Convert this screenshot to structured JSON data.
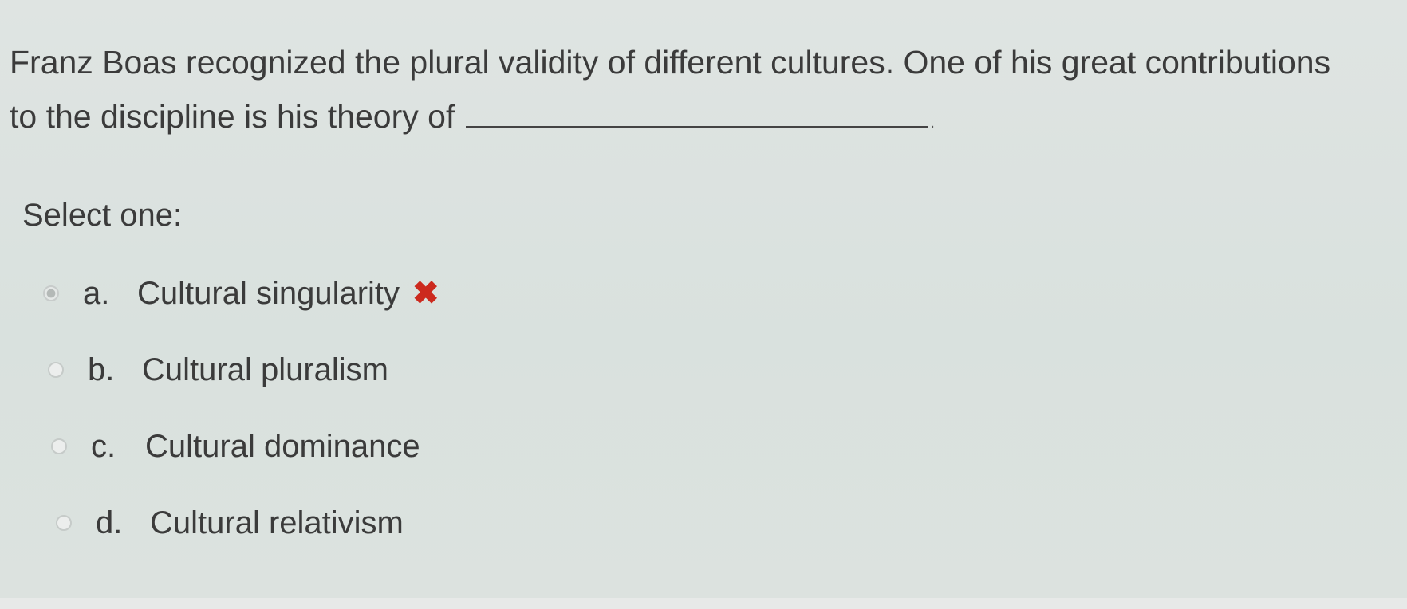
{
  "question": {
    "line1": "Franz Boas recognized the plural validity of different cultures. One of his great contributions",
    "line2": "to the discipline is his theory of",
    "blank_end": "."
  },
  "prompt": "Select one:",
  "options": [
    {
      "letter": "a.",
      "text": "Cultural singularity",
      "selected": true,
      "feedback_icon": "x-icon",
      "feedback_glyph": "✖"
    },
    {
      "letter": "b.",
      "text": "Cultural pluralism",
      "selected": false
    },
    {
      "letter": "c.",
      "text": "Cultural dominance",
      "selected": false
    },
    {
      "letter": "d.",
      "text": "Cultural relativism",
      "selected": false
    }
  ],
  "colors": {
    "wrong": "#cc2a1e",
    "text": "#3b3b3b",
    "background": "#dbe2df"
  }
}
